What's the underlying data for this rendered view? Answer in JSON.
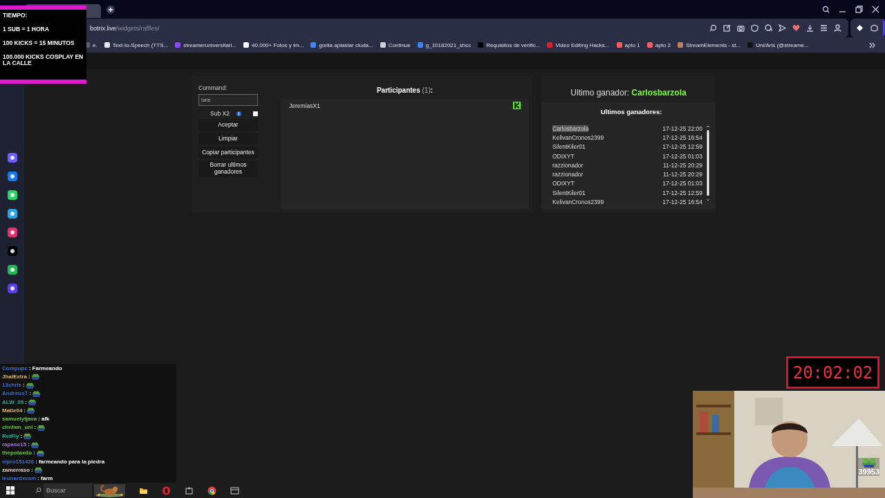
{
  "browser": {
    "address": {
      "domain": "botrix.live",
      "path": "/widgets/raffles/"
    },
    "bookmarks": [
      {
        "label": "e.",
        "color": "#5a6070"
      },
      {
        "label": "Text-to-Speech (TTS...",
        "color": "#e8e8e8"
      },
      {
        "label": "streameruniversitari...",
        "color": "#9146ff"
      },
      {
        "label": "40.000+ Fotos y Im...",
        "color": "#ffffff"
      },
      {
        "label": "gorila aplastar ciuda...",
        "color": "#4285f4"
      },
      {
        "label": "Continue",
        "color": "#d0d0d0"
      },
      {
        "label": "g_10182021_shcc",
        "color": "#3b82f6"
      },
      {
        "label": "Requisitos de verific...",
        "color": "#000000"
      },
      {
        "label": "Video Editing Hacks...",
        "color": "#e02020"
      },
      {
        "label": "apto 1",
        "color": "#ff5a5f"
      },
      {
        "label": "apto 2",
        "color": "#ff5a5f"
      },
      {
        "label": "StreamElements - st...",
        "color": "#c08060"
      },
      {
        "label": "Uni/Aris (@streame...",
        "color": "#111111"
      }
    ],
    "sidebar_icons": [
      {
        "color": "#6a5cff"
      },
      {
        "color": "#1877f2"
      },
      {
        "color": "#25d366"
      },
      {
        "color": "#2aa3e0"
      },
      {
        "color": "#e1306c"
      },
      {
        "color": "#000000"
      },
      {
        "color": "#1db954"
      },
      {
        "color": "#5b3cf0"
      }
    ]
  },
  "raffle": {
    "command": {
      "label": "Command:",
      "value": "!aris"
    },
    "sub_x2": {
      "label": "Sub X2",
      "checked": false
    },
    "buttons": [
      "Aceptar",
      "Limpiar",
      "Copiar participantes",
      "Borrar ultimos ganadores"
    ],
    "participants": {
      "title": "Participantes",
      "count": "(1)",
      "suffix": ":",
      "items": [
        {
          "name": "JeremiasX1",
          "kind": "kick"
        }
      ]
    },
    "last_winner": {
      "label": "Ultimo ganador:",
      "name": "Carlosbarzola"
    },
    "winners": {
      "title": "Ultimos ganadores:",
      "rows": [
        {
          "name": "Carlosbarzola",
          "date": "17-12-25 22:00",
          "selected": true
        },
        {
          "name": "KelivanCronos2399",
          "date": "17-12-25 16:54",
          "selected": false
        },
        {
          "name": "SilentKiler01",
          "date": "17-12-25 12:59",
          "selected": false
        },
        {
          "name": "ODIXYT",
          "date": "17-12-25 01:03",
          "selected": false
        },
        {
          "name": "razzionador",
          "date": "11-12-25 20:29",
          "selected": false
        },
        {
          "name": "razzionador",
          "date": "11-12-25 20:29",
          "selected": false
        },
        {
          "name": "ODIXYT",
          "date": "17-12-25 01:03",
          "selected": false
        },
        {
          "name": "SilentKiler01",
          "date": "17-12-25 12:59",
          "selected": false
        },
        {
          "name": "KelivanCronos2399",
          "date": "17-12-25 16:54",
          "selected": false
        }
      ]
    }
  },
  "timer_overlay": {
    "lines": [
      "TIEMPO:",
      "1 SUB = 1 HORA",
      "100 KICKS = 15 MINUTOS",
      "100.000 KICKS COSPLAY EN LA CALLE"
    ]
  },
  "chat": [
    {
      "user": "Compupc",
      "color": "#3a6fd0",
      "sep": ":",
      "kind": "text",
      "text": "Farmeando"
    },
    {
      "user": "JhalExtra",
      "color": "#d9b56a",
      "sep": ":",
      "kind": "emote"
    },
    {
      "user": "13chris",
      "color": "#3a6fd0",
      "sep": ":",
      "kind": "emote"
    },
    {
      "user": "AndreusT",
      "color": "#3a6fd0",
      "sep": ":",
      "kind": "emote"
    },
    {
      "user": "ALW_05",
      "color": "#2ab0a0",
      "sep": ":",
      "kind": "emote"
    },
    {
      "user": "Matie04",
      "color": "#d9b56a",
      "sep": ":",
      "kind": "emote"
    },
    {
      "user": "samuelytjava",
      "color": "#62c73c",
      "sep": ":",
      "kind": "text",
      "text": "afk"
    },
    {
      "user": "chntwn_uni",
      "color": "#62c73c",
      "sep": ":",
      "kind": "emote"
    },
    {
      "user": "RetFly",
      "color": "#2ab0a0",
      "sep": ":",
      "kind": "emote"
    },
    {
      "user": "rapaso15",
      "color": "#a070d0",
      "sep": ":",
      "kind": "emote"
    },
    {
      "user": "thepotaxdo",
      "color": "#62c73c",
      "sep": ":",
      "kind": "emote"
    },
    {
      "user": "elpro151426",
      "color": "#3a6fd0",
      "sep": ":",
      "kind": "text",
      "text": "farmeando para la piedra"
    },
    {
      "user": "zamerraso",
      "color": "#e0d0c0",
      "sep": ":",
      "kind": "emote"
    },
    {
      "user": "leonardxcam",
      "color": "#3a6fd0",
      "sep": ":",
      "kind": "text",
      "text": "farm"
    }
  ],
  "clock": {
    "time": "20:02:02"
  },
  "webcam": {
    "viewer_count": "39953"
  },
  "taskbar": {
    "search": {
      "placeholder": "Buscar"
    }
  }
}
